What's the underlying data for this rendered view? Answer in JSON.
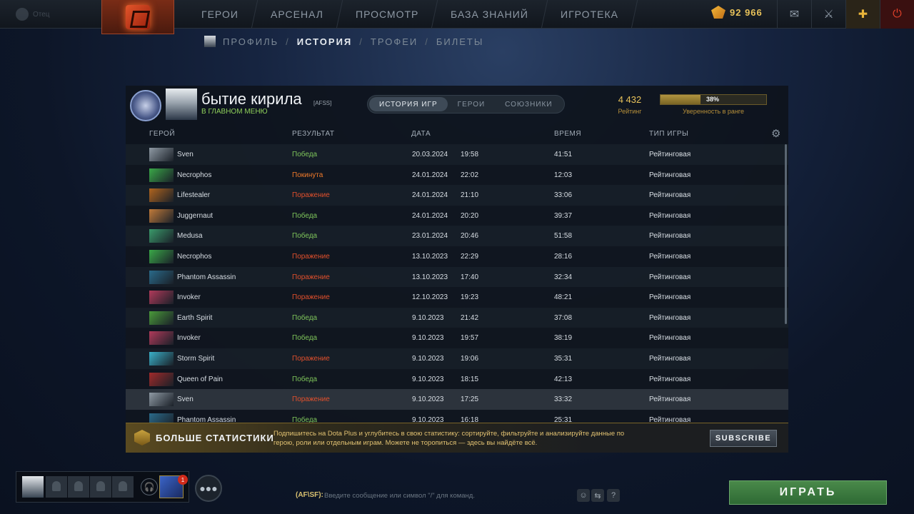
{
  "mini_profile": {
    "text": "Отец"
  },
  "nav": {
    "items": [
      "ГЕРОИ",
      "АРСЕНАЛ",
      "ПРОСМОТР",
      "БАЗА ЗНАНИЙ",
      "ИГРОТЕКА"
    ],
    "shards": "92 966"
  },
  "subnav": {
    "profile": "ПРОФИЛЬ",
    "history": "ИСТОРИЯ",
    "trophies": "ТРОФЕИ",
    "tickets": "БИЛЕТЫ",
    "sep": "/"
  },
  "player": {
    "name": "бытие кирила",
    "tag": "[AFSS]",
    "status": "В ГЛАВНОМ МЕНЮ"
  },
  "tabs": [
    "ИСТОРИЯ ИГР",
    "ГЕРОИ",
    "СОЮЗНИКИ"
  ],
  "rating": {
    "value": "4 432",
    "label": "Рейтинг"
  },
  "confidence": {
    "percent": 38,
    "percent_text": "38%",
    "label": "Уверенность в ранге"
  },
  "table": {
    "columns": {
      "hero": "ГЕРОЙ",
      "result": "РЕЗУЛЬТАТ",
      "date": "ДАТА",
      "time": "ВРЕМЯ",
      "type": "ТИП ИГРЫ"
    },
    "rows": [
      {
        "hero": "Sven",
        "result": "Победа",
        "status": "win",
        "date": "20.03.2024",
        "clock": "19:58",
        "duration": "41:51",
        "type": "Рейтинговая",
        "color": "#8f9aa4"
      },
      {
        "hero": "Necrophos",
        "result": "Покинута",
        "status": "abandon",
        "date": "24.01.2024",
        "clock": "22:02",
        "duration": "12:03",
        "type": "Рейтинговая",
        "color": "#3aa848"
      },
      {
        "hero": "Lifestealer",
        "result": "Поражение",
        "status": "loss",
        "date": "24.01.2024",
        "clock": "21:10",
        "duration": "33:06",
        "type": "Рейтинговая",
        "color": "#b0641e"
      },
      {
        "hero": "Juggernaut",
        "result": "Победа",
        "status": "win",
        "date": "24.01.2024",
        "clock": "20:20",
        "duration": "39:37",
        "type": "Рейтинговая",
        "color": "#c07a3a"
      },
      {
        "hero": "Medusa",
        "result": "Победа",
        "status": "win",
        "date": "23.01.2024",
        "clock": "20:46",
        "duration": "51:58",
        "type": "Рейтинговая",
        "color": "#3a9a6a"
      },
      {
        "hero": "Necrophos",
        "result": "Поражение",
        "status": "loss",
        "date": "13.10.2023",
        "clock": "22:29",
        "duration": "28:16",
        "type": "Рейтинговая",
        "color": "#3aa848"
      },
      {
        "hero": "Phantom Assassin",
        "result": "Поражение",
        "status": "loss",
        "date": "13.10.2023",
        "clock": "17:40",
        "duration": "32:34",
        "type": "Рейтинговая",
        "color": "#2a6a8a"
      },
      {
        "hero": "Invoker",
        "result": "Поражение",
        "status": "loss",
        "date": "12.10.2023",
        "clock": "19:23",
        "duration": "48:21",
        "type": "Рейтинговая",
        "color": "#b03a5a"
      },
      {
        "hero": "Earth Spirit",
        "result": "Победа",
        "status": "win",
        "date": "9.10.2023",
        "clock": "21:42",
        "duration": "37:08",
        "type": "Рейтинговая",
        "color": "#4a9a3a"
      },
      {
        "hero": "Invoker",
        "result": "Победа",
        "status": "win",
        "date": "9.10.2023",
        "clock": "19:57",
        "duration": "38:19",
        "type": "Рейтинговая",
        "color": "#b03a5a"
      },
      {
        "hero": "Storm Spirit",
        "result": "Поражение",
        "status": "loss",
        "date": "9.10.2023",
        "clock": "19:06",
        "duration": "35:31",
        "type": "Рейтинговая",
        "color": "#3ab0c8"
      },
      {
        "hero": "Queen of Pain",
        "result": "Победа",
        "status": "win",
        "date": "9.10.2023",
        "clock": "18:15",
        "duration": "42:13",
        "type": "Рейтинговая",
        "color": "#a02a2a"
      },
      {
        "hero": "Sven",
        "result": "Поражение",
        "status": "loss",
        "date": "9.10.2023",
        "clock": "17:25",
        "duration": "33:32",
        "type": "Рейтинговая",
        "color": "#8f9aa4",
        "selected": true
      },
      {
        "hero": "Phantom Assassin",
        "result": "Победа",
        "status": "win",
        "date": "9.10.2023",
        "clock": "16:18",
        "duration": "25:31",
        "type": "Рейтинговая",
        "color": "#2a6a8a"
      }
    ]
  },
  "dota_plus": {
    "title": "БОЛЬШЕ СТАТИСТИКИ",
    "text": "Подпишитесь на Dota Plus и углубитесь в свою статистику: сортируйте, фильтруйте и анализируйте данные по герою, роли или отдельным играм. Можете не торопиться — здесь вы найдёте всё.",
    "button": "SUBSCRIBE"
  },
  "party": {
    "badge": "1"
  },
  "chat": {
    "channel": "(AF\\SF):",
    "placeholder": "Введите сообщение или символ \"/\" для команд.",
    "help": "?"
  },
  "play_button": "ИГРАТЬ"
}
